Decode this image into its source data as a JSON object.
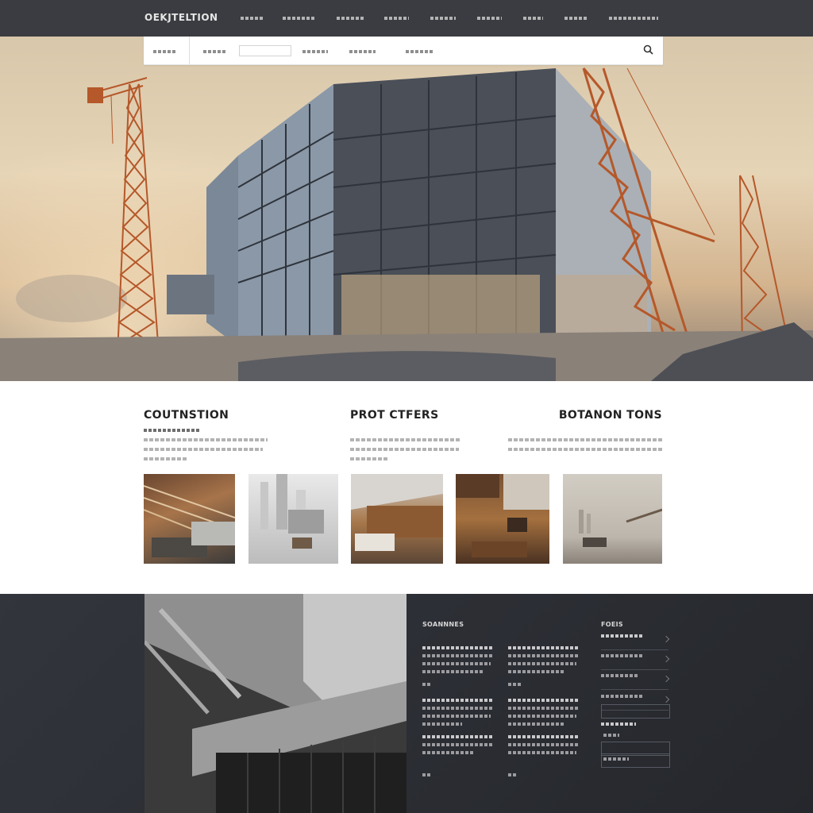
{
  "header": {
    "brand": "OEKJTELTION",
    "nav": [
      "",
      "",
      "",
      "",
      "",
      "",
      "",
      "",
      ""
    ]
  },
  "subnav": {
    "items": [
      "",
      "",
      "",
      "",
      ""
    ],
    "search_placeholder": "",
    "search_icon": "search-icon"
  },
  "hero": {
    "image": "construction-site-hero"
  },
  "features": [
    {
      "title": "COUTNSTION"
    },
    {
      "title": "PROT CTFERS"
    },
    {
      "title": "BOTANON TONS"
    }
  ],
  "gallery": {
    "items": [
      "interior-timber-ceiling",
      "foggy-skyline",
      "wood-workshop",
      "office-interior",
      "demolition-field"
    ]
  },
  "footer": {
    "photo": "concrete-facade",
    "col1_title": "SOANNNES",
    "col2_title": "FOEIS"
  },
  "colors": {
    "topbar": "#3a3c41",
    "footer": "#2c2f35",
    "crane": "#c0642e",
    "glass": "#7c8ea0"
  }
}
